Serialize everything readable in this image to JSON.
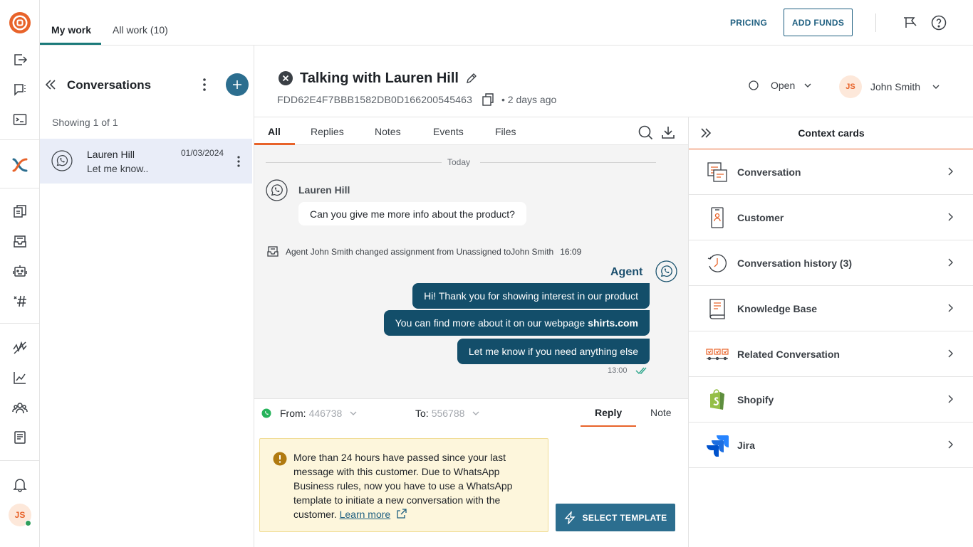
{
  "work_tabs": [
    {
      "label": "My work"
    },
    {
      "label": "All work (10)"
    }
  ],
  "topbar": {
    "pricing_label": "PRICING",
    "add_funds_label": "ADD FUNDS"
  },
  "rail_user": {
    "initials": "JS"
  },
  "conversation_list": {
    "title": "Conversations",
    "showing": "Showing 1 of 1",
    "items": [
      {
        "name": "Lauren Hill",
        "preview": "Let me know..",
        "date": "01/03/2024"
      }
    ]
  },
  "conversation": {
    "title": "Talking with Lauren Hill",
    "id": "FDD62E4F7BBB1582DB0D166200545463",
    "age": "• 2 days ago",
    "status": "Open",
    "agent": {
      "initials": "JS",
      "name": "John Smith"
    }
  },
  "tabs": [
    {
      "label": "All"
    },
    {
      "label": "Replies"
    },
    {
      "label": "Notes"
    },
    {
      "label": "Events"
    },
    {
      "label": "Files"
    }
  ],
  "thread": {
    "date_divider": "Today",
    "incoming": {
      "sender": "Lauren Hill",
      "text": "Can you give me more info about the product?"
    },
    "event": {
      "text": "Agent John Smith changed assignment from Unassigned toJohn Smith",
      "time": "16:09"
    },
    "outgoing": {
      "sender": "Agent",
      "messages": [
        {
          "text": "Hi! Thank you for showing interest in our product"
        },
        {
          "text": "You can find more about it on our webpage",
          "bold": "shirts.com"
        },
        {
          "text": "Let me know if you need anything else"
        }
      ],
      "time": "13:00"
    }
  },
  "compose": {
    "from_label": "From:",
    "from_value": "446738",
    "to_label": "To:",
    "to_value": "556788",
    "tabs": [
      {
        "label": "Reply"
      },
      {
        "label": "Note"
      }
    ],
    "warning": "More than 24 hours have passed since your last message with this customer. Due to WhatsApp Business rules, now you have to use a WhatsApp template to initiate a new conversation with the customer.",
    "learn_more": "Learn more",
    "select_template": "SELECT TEMPLATE"
  },
  "context": {
    "title": "Context cards",
    "cards": [
      {
        "label": "Conversation",
        "icon": "conversation-card-icon"
      },
      {
        "label": "Customer",
        "icon": "customer-card-icon"
      },
      {
        "label": "Conversation history (3)",
        "icon": "history-clock-icon"
      },
      {
        "label": "Knowledge Base",
        "icon": "knowledge-book-icon"
      },
      {
        "label": "Related Conversation",
        "icon": "related-conversation-icon"
      },
      {
        "label": "Shopify",
        "icon": "shopify-logo-icon"
      },
      {
        "label": "Jira",
        "icon": "jira-logo-icon"
      }
    ]
  },
  "colors": {
    "accent": "#e8632a",
    "primary": "#2c6e8f",
    "agent_bubble": "#134e6a",
    "selected_row": "#e9edf8"
  }
}
